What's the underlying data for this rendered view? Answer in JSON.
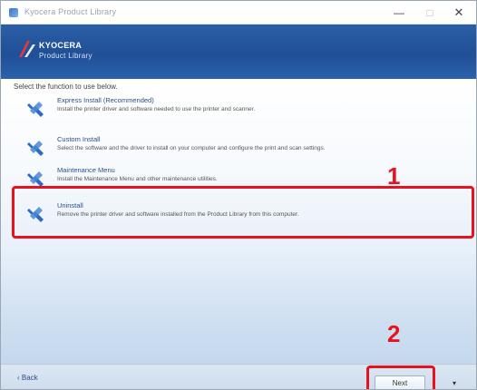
{
  "window": {
    "title": "Kyocera Product Library",
    "controls": {
      "minimize": "—",
      "maximize": "□",
      "close": "✕"
    }
  },
  "banner": {
    "line1": "KYOCERA",
    "line2": "Product Library"
  },
  "content": {
    "instruction": "Select the function to use below.",
    "options": [
      {
        "title": "Express Install (Recommended)",
        "description": "Install the printer driver and software needed to use the printer and scanner."
      },
      {
        "title": "Custom Install",
        "description": "Select the software and the driver to install on your computer and configure the print and scan settings."
      },
      {
        "title": "Maintenance Menu",
        "description": "Install the Maintenance Menu and other maintenance utilities."
      },
      {
        "title": "Uninstall",
        "description": "Remove the printer driver and software installed from the Product Library from this computer."
      }
    ],
    "icon_name": "tools-icon"
  },
  "callouts": {
    "first": "1",
    "second": "2"
  },
  "footer": {
    "back_label": "‹ Back",
    "next_label": "Next",
    "menu_label": "▾"
  },
  "colors": {
    "banner": "#1f4f97",
    "highlight": "#e8121f",
    "icon": "#2c6bc5"
  }
}
